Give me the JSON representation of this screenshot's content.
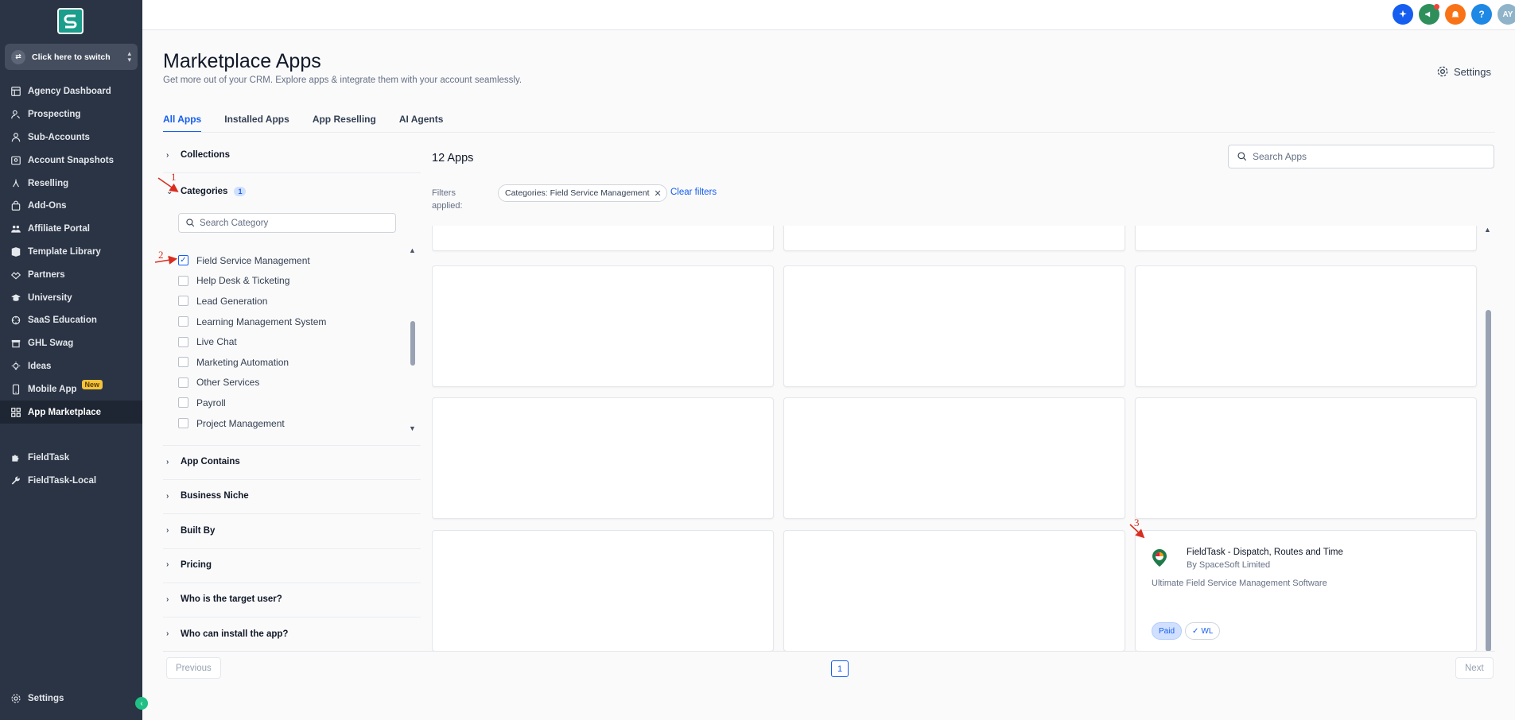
{
  "sidebar": {
    "switcher_label": "Click here to switch",
    "items": [
      {
        "label": "Agency Dashboard",
        "icon": "dashboard-icon"
      },
      {
        "label": "Prospecting",
        "icon": "prospecting-icon"
      },
      {
        "label": "Sub-Accounts",
        "icon": "building-icon"
      },
      {
        "label": "Account Snapshots",
        "icon": "snapshot-icon"
      },
      {
        "label": "Reselling",
        "icon": "reselling-icon"
      },
      {
        "label": "Add-Ons",
        "icon": "bag-icon"
      },
      {
        "label": "Affiliate Portal",
        "icon": "users-icon"
      },
      {
        "label": "Template Library",
        "icon": "library-icon"
      },
      {
        "label": "Partners",
        "icon": "handshake-icon"
      },
      {
        "label": "University",
        "icon": "graduation-icon"
      },
      {
        "label": "SaaS Education",
        "icon": "education-icon"
      },
      {
        "label": "GHL Swag",
        "icon": "store-icon"
      },
      {
        "label": "Ideas",
        "icon": "lightbulb-icon"
      },
      {
        "label": "Mobile App",
        "icon": "mobile-icon",
        "badge": "New"
      },
      {
        "label": "App Marketplace",
        "icon": "grid-icon",
        "active": true
      }
    ],
    "custom_items": [
      {
        "label": "FieldTask",
        "icon": "puzzle-icon"
      },
      {
        "label": "FieldTask-Local",
        "icon": "wrench-icon"
      }
    ],
    "settings_label": "Settings"
  },
  "topbar": {
    "avatar_initials": "AY",
    "colors": {
      "blue": "#155eef",
      "green": "#2f8f5b",
      "orange": "#f97316",
      "help": "#1e88e5",
      "avatar": "#8fb3c9"
    }
  },
  "header": {
    "title": "Marketplace Apps",
    "subtitle": "Get more out of your CRM. Explore apps & integrate them with your account seamlessly.",
    "settings_label": "Settings"
  },
  "tabs": [
    {
      "label": "All Apps",
      "active": true
    },
    {
      "label": "Installed Apps"
    },
    {
      "label": "App Reselling"
    },
    {
      "label": "AI Agents"
    }
  ],
  "filters": {
    "collections_label": "Collections",
    "categories_label": "Categories",
    "categories_count": "1",
    "category_search_placeholder": "Search Category",
    "categories": [
      {
        "label": "Field Service Management",
        "checked": true
      },
      {
        "label": "Help Desk & Ticketing",
        "checked": false
      },
      {
        "label": "Lead Generation",
        "checked": false
      },
      {
        "label": "Learning Management System",
        "checked": false
      },
      {
        "label": "Live Chat",
        "checked": false
      },
      {
        "label": "Marketing Automation",
        "checked": false
      },
      {
        "label": "Other Services",
        "checked": false
      },
      {
        "label": "Payroll",
        "checked": false
      },
      {
        "label": "Project Management",
        "checked": false
      }
    ],
    "sections": [
      "App Contains",
      "Business Niche",
      "Built By",
      "Pricing",
      "Who is the target user?",
      "Who can install the app?"
    ]
  },
  "results": {
    "count_label": "12 Apps",
    "search_placeholder": "Search Apps",
    "filters_applied_label_line1": "Filters",
    "filters_applied_label_line2": "applied:",
    "chip_label": "Categories: Field Service Management",
    "clear_filters_label": "Clear filters",
    "featured_app": {
      "title": "FieldTask - Dispatch, Routes and Time",
      "by": "By SpaceSoft Limited",
      "description": "Ultimate Field Service Management Software",
      "badges": [
        "Paid",
        "WL"
      ]
    }
  },
  "pagination": {
    "previous_label": "Previous",
    "next_label": "Next",
    "current_page": "1"
  },
  "annotations": [
    "1",
    "2",
    "3"
  ]
}
